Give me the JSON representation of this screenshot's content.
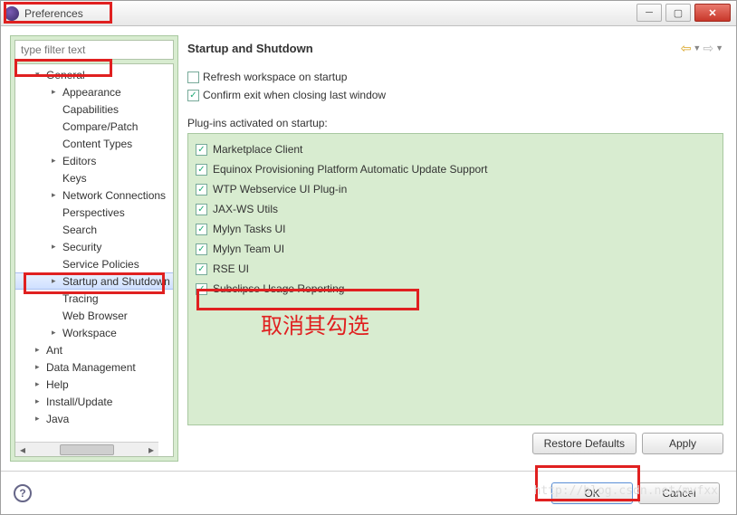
{
  "window": {
    "title": "Preferences"
  },
  "filter": {
    "placeholder": "type filter text"
  },
  "tree": {
    "items": [
      {
        "label": "General",
        "level": 0,
        "expand": "▾"
      },
      {
        "label": "Appearance",
        "level": 1,
        "expand": "▸"
      },
      {
        "label": "Capabilities",
        "level": 1,
        "expand": ""
      },
      {
        "label": "Compare/Patch",
        "level": 1,
        "expand": ""
      },
      {
        "label": "Content Types",
        "level": 1,
        "expand": ""
      },
      {
        "label": "Editors",
        "level": 1,
        "expand": "▸"
      },
      {
        "label": "Keys",
        "level": 1,
        "expand": ""
      },
      {
        "label": "Network Connections",
        "level": 1,
        "expand": "▸"
      },
      {
        "label": "Perspectives",
        "level": 1,
        "expand": ""
      },
      {
        "label": "Search",
        "level": 1,
        "expand": ""
      },
      {
        "label": "Security",
        "level": 1,
        "expand": "▸"
      },
      {
        "label": "Service Policies",
        "level": 1,
        "expand": ""
      },
      {
        "label": "Startup and Shutdown",
        "level": 1,
        "expand": "▸",
        "sel": true
      },
      {
        "label": "Tracing",
        "level": 1,
        "expand": ""
      },
      {
        "label": "Web Browser",
        "level": 1,
        "expand": ""
      },
      {
        "label": "Workspace",
        "level": 1,
        "expand": "▸"
      },
      {
        "label": "Ant",
        "level": 0,
        "expand": "▸"
      },
      {
        "label": "Data Management",
        "level": 0,
        "expand": "▸"
      },
      {
        "label": "Help",
        "level": 0,
        "expand": "▸"
      },
      {
        "label": "Install/Update",
        "level": 0,
        "expand": "▸"
      },
      {
        "label": "Java",
        "level": 0,
        "expand": "▸"
      }
    ]
  },
  "page": {
    "heading": "Startup and Shutdown",
    "refresh_label": "Refresh workspace on startup",
    "refresh_checked": false,
    "confirm_label": "Confirm exit when closing last window",
    "confirm_checked": true,
    "plugins_label": "Plug-ins activated on startup:",
    "plugins": [
      {
        "label": "Marketplace Client",
        "checked": true
      },
      {
        "label": "Equinox Provisioning Platform Automatic Update Support",
        "checked": true
      },
      {
        "label": "WTP Webservice UI Plug-in",
        "checked": true
      },
      {
        "label": "JAX-WS Utils",
        "checked": true
      },
      {
        "label": "Mylyn Tasks UI",
        "checked": true
      },
      {
        "label": "Mylyn Team UI",
        "checked": true
      },
      {
        "label": "RSE UI",
        "checked": true
      },
      {
        "label": "Subclipse Usage Reporting",
        "checked": true
      }
    ]
  },
  "buttons": {
    "restore": "Restore Defaults",
    "apply": "Apply",
    "ok": "OK",
    "cancel": "Cancel"
  },
  "annotation": "取消其勾选",
  "watermark": "http://blog.csdn.net/myfxx"
}
